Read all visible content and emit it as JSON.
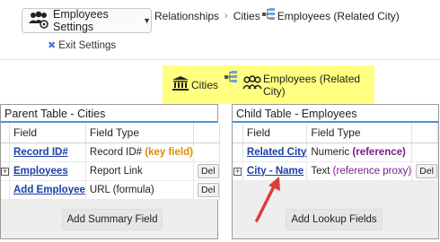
{
  "header": {
    "settings_label": "Employees Settings",
    "exit_label": "Exit Settings"
  },
  "breadcrumb": {
    "items": [
      "Relationships",
      "Cities",
      "Employees (Related City)"
    ]
  },
  "relationship": {
    "parent": "Cities",
    "child": "Employees (Related City)"
  },
  "parent_table": {
    "title": "Parent Table - Cities",
    "columns": [
      "Field",
      "Field Type"
    ],
    "rows": [
      {
        "field": "Record ID#",
        "type": "Record ID#",
        "note": "(key field)",
        "del": ""
      },
      {
        "field": "Employees",
        "type": "Report Link",
        "note": "",
        "del": "Del"
      },
      {
        "field": "Add Employee",
        "type": "URL (formula)",
        "note": "",
        "del": "Del"
      }
    ],
    "add_button": "Add Summary Field"
  },
  "child_table": {
    "title": "Child Table - Employees",
    "columns": [
      "Field",
      "Field Type"
    ],
    "rows": [
      {
        "field": "Related City",
        "type": "Numeric",
        "note": "(reference)",
        "del": ""
      },
      {
        "field": "City - Name",
        "type": "Text",
        "note": "(reference proxy)",
        "del": "Del"
      }
    ],
    "add_button": "Add Lookup Fields"
  },
  "colors": {
    "highlight": "#ffff80",
    "link": "#1b3fa8",
    "key_field": "#e08a00",
    "reference": "#7a1d8c",
    "arrow": "#e03b3b",
    "title_rule": "#4a90d9"
  }
}
